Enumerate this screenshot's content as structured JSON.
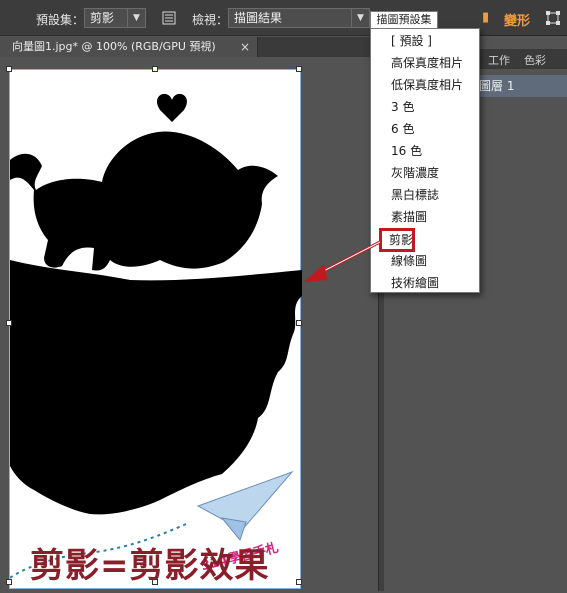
{
  "toolbar": {
    "preset_label": "預設集：",
    "preset_value": "剪影",
    "view_label": "檢視：",
    "view_value": "描圖結果",
    "orange_label": "變形"
  },
  "document": {
    "tab_title": "向量圖1.jpg* @ 100% (RGB/GPU 預視)",
    "close_glyph": "×"
  },
  "panel": {
    "tabs": [
      "工作",
      "色彩"
    ],
    "layer_name": "圖層 1"
  },
  "menu": {
    "title": "描圖預設集",
    "items": [
      "[ 預設 ]",
      "高保真度相片",
      "低保真度相片",
      "3 色",
      "6 色",
      "16 色",
      "灰階濃度",
      "黑白標誌",
      "素描圖",
      "剪影",
      "線條圖",
      "技術繪圖"
    ],
    "selected_index": 9
  },
  "artwork": {
    "caption": "剪影=剪影效果",
    "watermark": "314學習手札"
  },
  "colors": {
    "highlight": "#c0191f",
    "caption": "#8a1f2a",
    "watermark": "#d4237a"
  }
}
